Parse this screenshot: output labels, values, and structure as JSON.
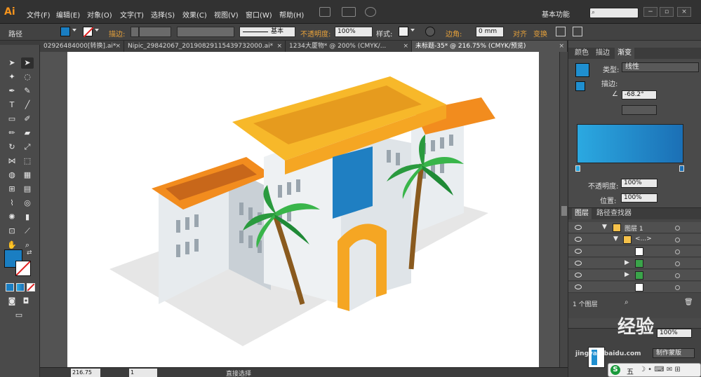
{
  "app": {
    "logo": "Ai"
  },
  "menu": [
    {
      "label": "文件(F)"
    },
    {
      "label": "编辑(E)"
    },
    {
      "label": "对象(O)"
    },
    {
      "label": "文字(T)"
    },
    {
      "label": "选择(S)"
    },
    {
      "label": "效果(C)"
    },
    {
      "label": "视图(V)"
    },
    {
      "label": "窗口(W)"
    },
    {
      "label": "帮助(H)"
    }
  ],
  "workspace": {
    "label": "基本功能"
  },
  "control": {
    "path_label": "路径",
    "stroke_label": "描边:",
    "stroke_style_value": "基本",
    "opacity_label": "不透明度:",
    "opacity_value": "100%",
    "style_label": "样式:",
    "corner_label": "边角:",
    "corner_value": "0 mm",
    "align_label": "对齐",
    "transform_label": "变换",
    "fill_color": "#1a7ec2"
  },
  "tabs": [
    {
      "label": "02926484000[转换].ai*"
    },
    {
      "label": "Nipic_29842067_20190829115439732000.ai*"
    },
    {
      "label": "1234大厦物* @ 200% (CMYK/..."
    },
    {
      "label": "未标题-35* @ 216.75% (CMYK/预览)"
    }
  ],
  "status": {
    "zoom": "216.75",
    "page": "1",
    "tool_text": "直接选择"
  },
  "gradient_panel": {
    "tabs": [
      {
        "label": "颜色"
      },
      {
        "label": "描边"
      },
      {
        "label": "渐变"
      }
    ],
    "type_label": "类型:",
    "type_value": "线性",
    "stroke_label": "描边:",
    "angle_value": "-68.2°",
    "opacity_label": "不透明度:",
    "opacity_value": "100%",
    "position_label": "位置:",
    "position_value": "100%",
    "start_color": "#2ba9e1",
    "end_color": "#1b6fb5"
  },
  "layers_panel": {
    "tabs": [
      {
        "label": "图层"
      },
      {
        "label": "路径查找器"
      }
    ],
    "rows": [
      {
        "name": "图层 1"
      },
      {
        "name": "<...>"
      },
      {
        "name": ""
      },
      {
        "name": ""
      },
      {
        "name": ""
      },
      {
        "name": ""
      }
    ],
    "footer": "1 个图层"
  },
  "dock": {
    "create_label": "制作蒙版",
    "opacity_value": "100%"
  },
  "watermark": {
    "text": "经验",
    "sub": "jingyan.baidu.com"
  },
  "ime": {
    "text": "五"
  }
}
